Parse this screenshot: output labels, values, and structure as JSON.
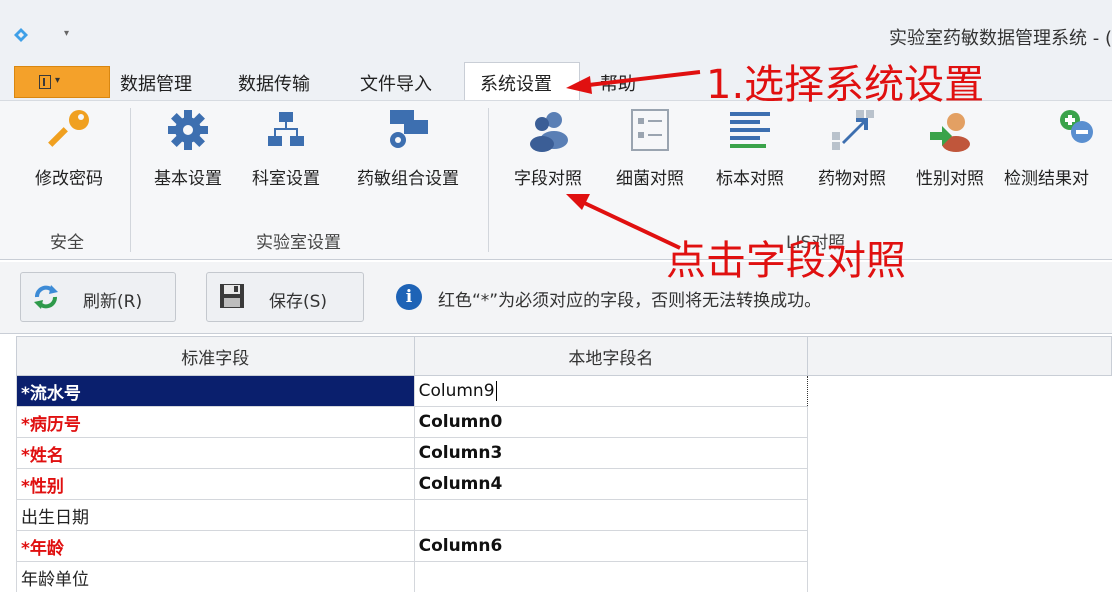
{
  "window": {
    "title": "实验室药敏数据管理系统 - ("
  },
  "tabs": [
    {
      "label": "数据管理"
    },
    {
      "label": "数据传输"
    },
    {
      "label": "文件导入"
    },
    {
      "label": "系统设置"
    },
    {
      "label": "帮助"
    }
  ],
  "ribbon": {
    "buttons": [
      {
        "label": "修改密码",
        "icon": "key-icon"
      },
      {
        "label": "基本设置",
        "icon": "gear-icon"
      },
      {
        "label": "科室设置",
        "icon": "org-chart-icon"
      },
      {
        "label": "药敏组合设置",
        "icon": "settings-combo-icon"
      },
      {
        "label": "字段对照",
        "icon": "users-icon"
      },
      {
        "label": "细菌对照",
        "icon": "list-icon"
      },
      {
        "label": "标本对照",
        "icon": "lines-icon"
      },
      {
        "label": "药物对照",
        "icon": "expand-arrow-icon"
      },
      {
        "label": "性别对照",
        "icon": "user-arrow-icon"
      },
      {
        "label": "检测结果对",
        "icon": "add-remove-icon"
      }
    ],
    "groups": [
      {
        "label": "安全"
      },
      {
        "label": "实验室设置"
      },
      {
        "label": "LIS对照"
      }
    ]
  },
  "toolbar": {
    "refresh_label": "刷新(R)",
    "save_label": "保存(S)",
    "info_text": "红色“*”为必须对应的字段，否则将无法转换成功。"
  },
  "grid": {
    "columns": [
      "标准字段",
      "本地字段名"
    ],
    "rows": [
      {
        "field": "*流水号",
        "local": "Column9"
      },
      {
        "field": "*病历号",
        "local": "Column0"
      },
      {
        "field": "*姓名",
        "local": "Column3"
      },
      {
        "field": "*性别",
        "local": "Column4"
      },
      {
        "field": "出生日期",
        "local": ""
      },
      {
        "field": "*年龄",
        "local": "Column6"
      },
      {
        "field": "年龄单位",
        "local": ""
      }
    ]
  },
  "annotations": {
    "step1": "1.选择系统设置",
    "step2": "点击字段对照"
  },
  "colors": {
    "required_red": "#e01010",
    "selected_row": "#0a1f6d",
    "file_button": "#f4a12a",
    "annotation": "#e01010"
  }
}
